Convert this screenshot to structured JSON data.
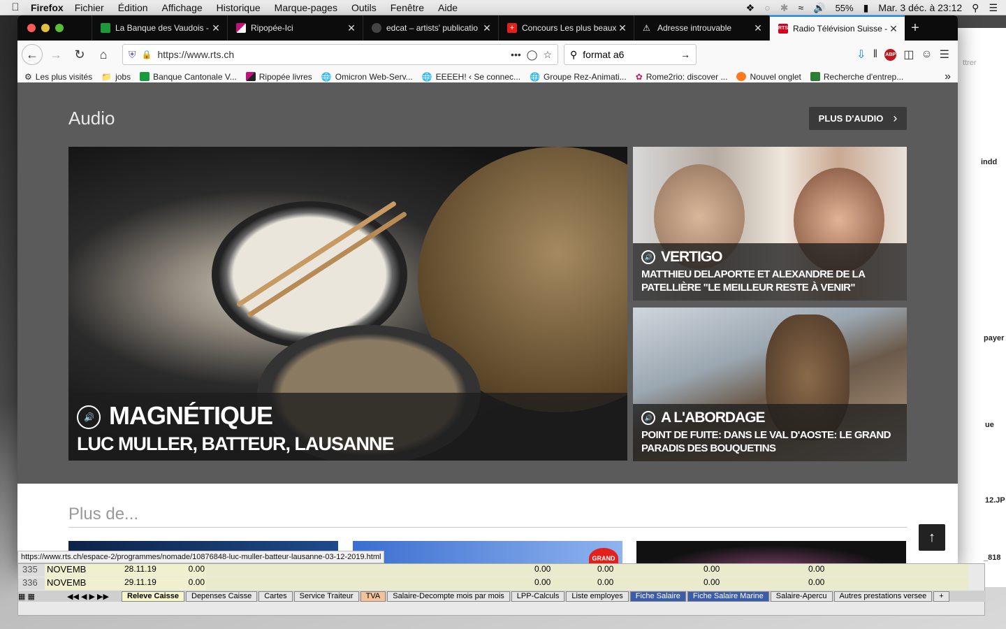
{
  "menubar": {
    "app": "Firefox",
    "items": [
      "Fichier",
      "Édition",
      "Affichage",
      "Historique",
      "Marque-pages",
      "Outils",
      "Fenêtre",
      "Aide"
    ],
    "battery": "55%",
    "datetime": "Mar. 3 déc. à 23:12"
  },
  "tabs": [
    {
      "title": "La Banque des Vaudois -",
      "color": "#1a9a3a"
    },
    {
      "title": "Ripopée-Ici",
      "color": "#c0127a"
    },
    {
      "title": "edcat – artists' publicatio",
      "color": "#444444"
    },
    {
      "title": "Concours Les plus beaux",
      "color": "#e3201b"
    },
    {
      "title": "Adresse introuvable",
      "color": "#ffffff"
    },
    {
      "title": "Radio Télévision Suisse -",
      "color": "#d2001e"
    }
  ],
  "nav": {
    "url": "https://www.rts.ch",
    "search_value": "format a6"
  },
  "bookmarks": [
    "Les plus visités",
    "jobs",
    "Banque Cantonale V...",
    "Ripopée livres",
    "Omicron Web-Serv...",
    "EEEEH! ‹ Se connec...",
    "Groupe Rez-Animati...",
    "Rome2rio: discover ...",
    "Nouvel onglet",
    "Recherche d'entrep..."
  ],
  "page": {
    "section_title": "Audio",
    "more_audio": "PLUS D'AUDIO",
    "cards": [
      {
        "show": "MAGNÉTIQUE",
        "title": "LUC MULLER, BATTEUR, LAUSANNE"
      },
      {
        "show": "VERTIGO",
        "title": "MATTHIEU DELAPORTE ET ALEXANDRE DE LA PATELLIÈRE \"LE MEILLEUR RESTE À VENIR\""
      },
      {
        "show": "A L'ABORDAGE",
        "title": "POINT DE FUITE: DANS LE VAL D'AOSTE: LE GRAND PARADIS DES BOUQUETINS"
      }
    ],
    "plus_title": "Plus de...",
    "thumb_badge": "GRAND",
    "status_url": "https://www.rts.ch/espace-2/programmes/nomade/10876848-luc-muller-batteur-lausanne-03-12-2019.html"
  },
  "sheet": {
    "rows": [
      {
        "n": "335",
        "month": "NOVEMB",
        "date": "28.11.19",
        "v": "0.00"
      },
      {
        "n": "336",
        "month": "NOVEMB",
        "date": "29.11.19",
        "v": "0.00"
      }
    ],
    "tabs": [
      "Releve Caisse",
      "Depenses Caisse",
      "Cartes",
      "Service Traiteur",
      "TVA",
      "Salaire-Decompte mois par mois",
      "LPP-Calculs",
      "Liste employes",
      "Fiche Salaire",
      "Fiche Salaire Marine",
      "Salaire-Apercu",
      "Autres prestations versee"
    ]
  },
  "desktop": {
    "labels": [
      "ttrer",
      "indd",
      "payer",
      "ue",
      "12.JP",
      "_818"
    ]
  }
}
